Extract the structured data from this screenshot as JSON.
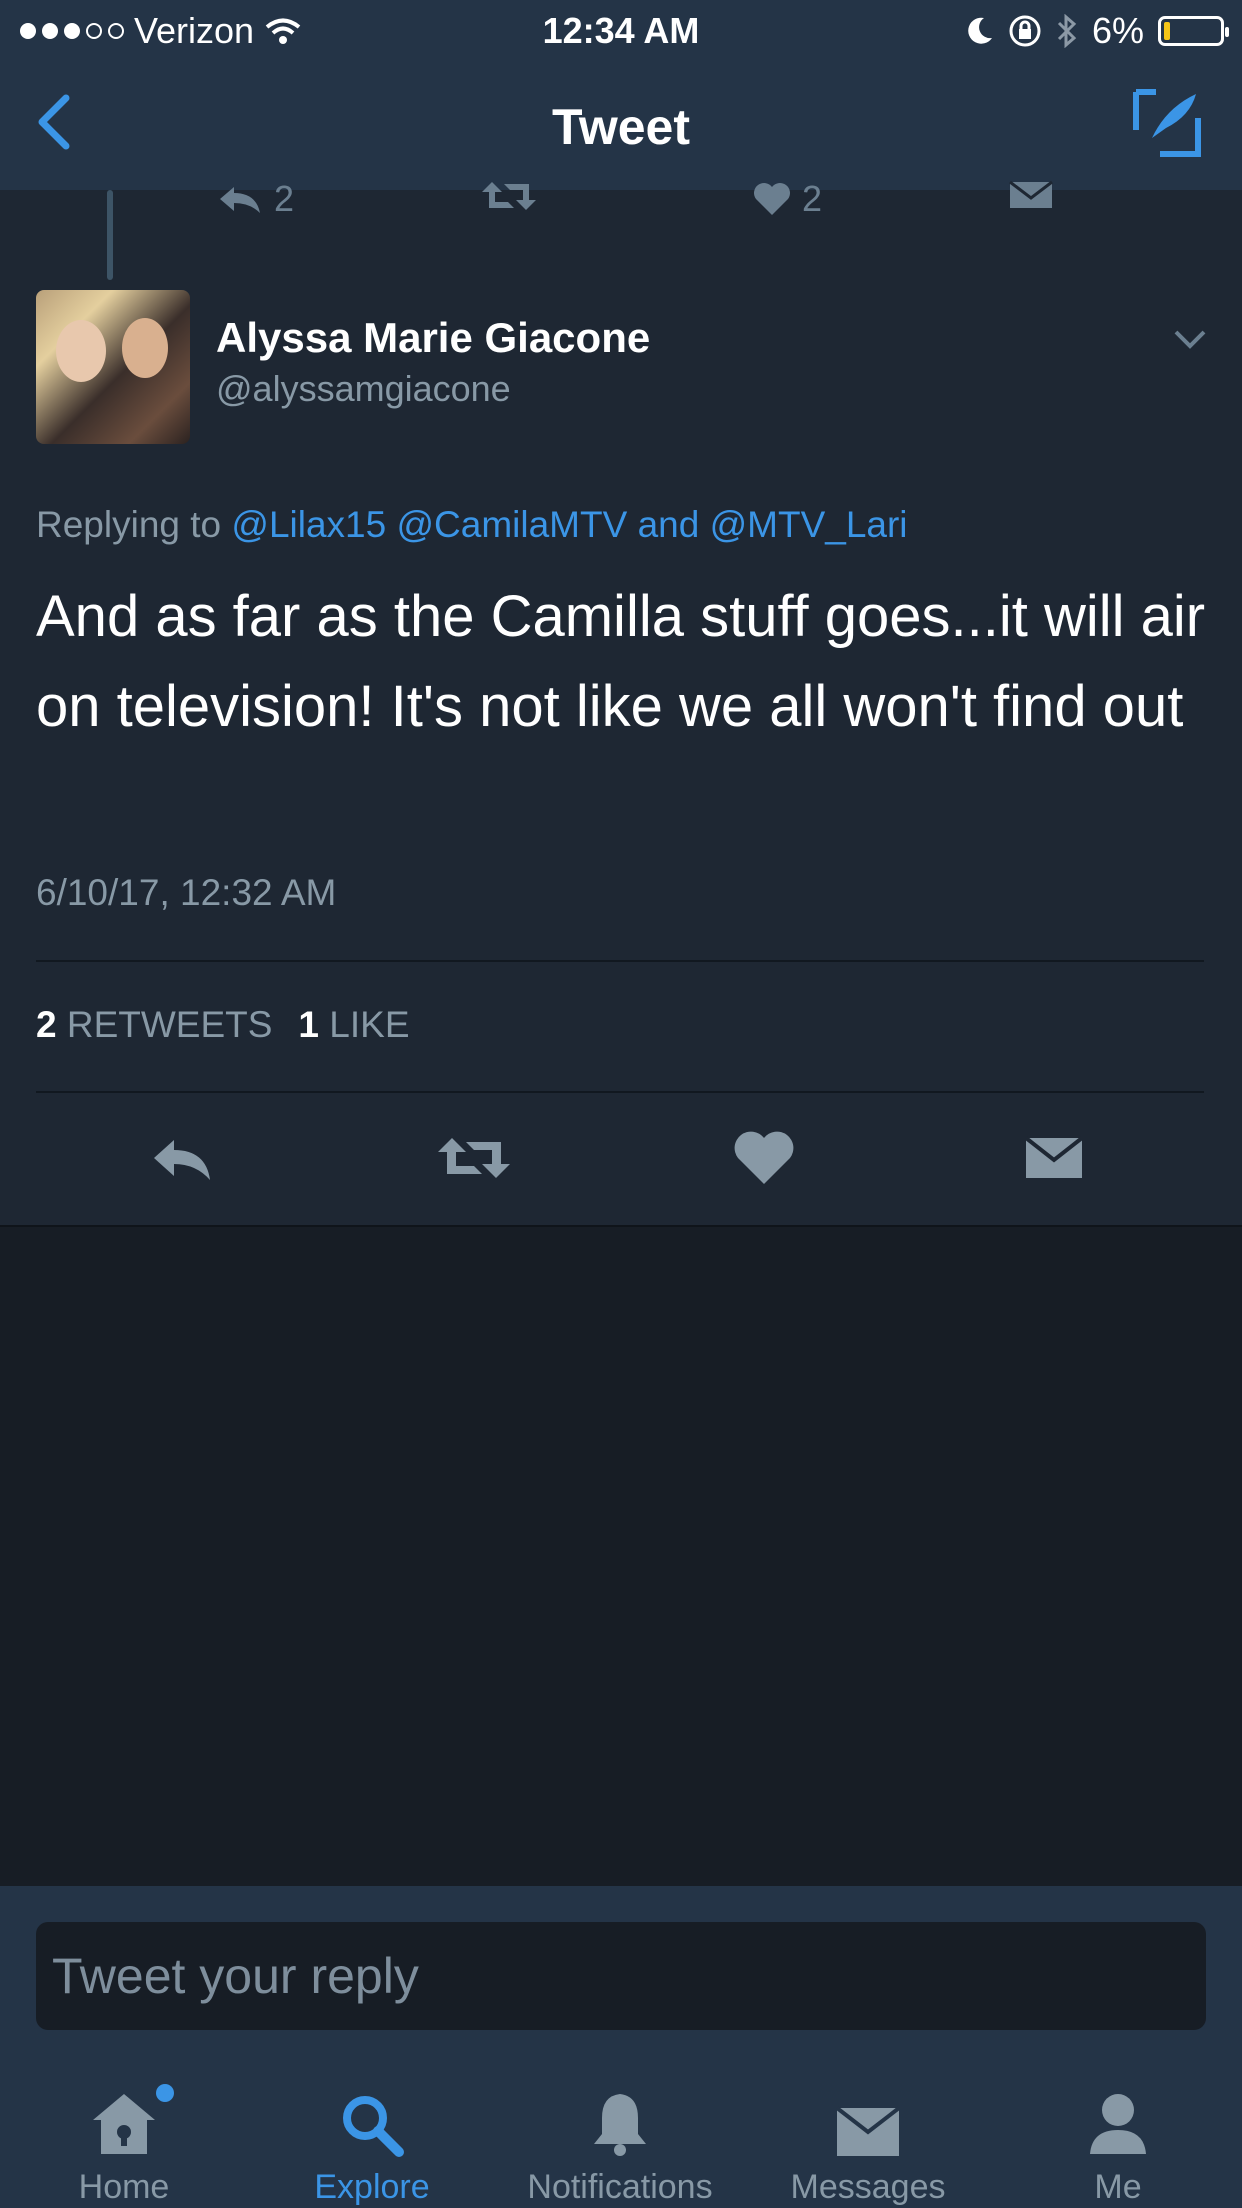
{
  "status_bar": {
    "carrier": "Verizon",
    "time": "12:34 AM",
    "battery": "6%"
  },
  "nav": {
    "title": "Tweet"
  },
  "previous_tweet_actions": {
    "reply_count": "2",
    "like_count": "2"
  },
  "tweet": {
    "author_name": "Alyssa Marie Giacone",
    "author_handle": "@alyssamgiacone",
    "replying_prefix": "Replying to",
    "mention_1": "@Lilax15",
    "mention_2": "@CamilaMTV",
    "mention_joiner": "and",
    "mention_3": "@MTV_Lari",
    "text": "And as far as the Camilla stuff goes...it will air on television! It's not like we all won't find out",
    "timestamp": "6/10/17, 12:32 AM",
    "retweets_count": "2",
    "retweets_label": "RETWEETS",
    "likes_count": "1",
    "likes_label": "LIKE"
  },
  "reply": {
    "placeholder": "Tweet your reply"
  },
  "tabbar": {
    "tabs": [
      {
        "label": "Home",
        "icon": "home-icon"
      },
      {
        "label": "Explore",
        "icon": "search-icon"
      },
      {
        "label": "Notifications",
        "icon": "bell-icon"
      },
      {
        "label": "Messages",
        "icon": "envelope-icon"
      },
      {
        "label": "Me",
        "icon": "person-icon"
      }
    ],
    "active": "Explore"
  },
  "colors": {
    "accent": "#3b95e6",
    "bar_bg": "#243447",
    "card_bg": "#1e2733",
    "page_bg": "#171d25",
    "muted_text": "#8899a6"
  }
}
